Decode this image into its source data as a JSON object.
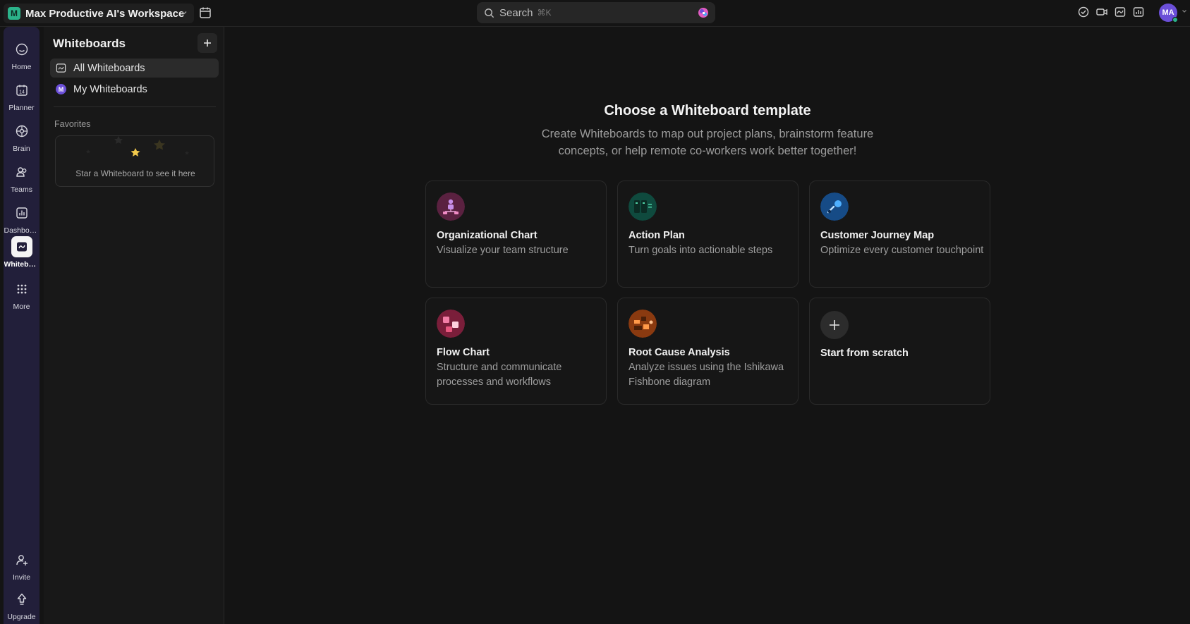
{
  "topbar": {
    "workspace_initial": "M",
    "workspace_name": "Max Productive AI's Workspace",
    "search_placeholder": "Search",
    "search_shortcut": "⌘K",
    "user_initials": "MA"
  },
  "rail": {
    "items": [
      {
        "label": "Home",
        "icon": "home-icon"
      },
      {
        "label": "Planner",
        "icon": "calendar-icon"
      },
      {
        "label": "Brain",
        "icon": "brain-icon"
      },
      {
        "label": "Teams",
        "icon": "teams-icon"
      },
      {
        "label": "Dashboa...",
        "icon": "dashboard-icon"
      },
      {
        "label": "Whitebo...",
        "icon": "whiteboard-icon",
        "active": true
      },
      {
        "label": "More",
        "icon": "grid-icon"
      }
    ],
    "bottom": [
      {
        "label": "Invite",
        "icon": "invite-icon"
      },
      {
        "label": "Upgrade",
        "icon": "upgrade-icon"
      }
    ]
  },
  "sidebar": {
    "title": "Whiteboards",
    "items": [
      {
        "label": "All Whiteboards",
        "icon": "whiteboard-icon",
        "active": true
      },
      {
        "label": "My Whiteboards",
        "icon": "user-badge-icon",
        "badge": "M"
      }
    ],
    "favorites_label": "Favorites",
    "favorites_empty": "Star a Whiteboard to see it here"
  },
  "main": {
    "title": "Choose a Whiteboard template",
    "subtitle": "Create Whiteboards to map out project plans, brainstorm feature concepts, or help remote co-workers work better together!",
    "templates": [
      {
        "title": "Organizational Chart",
        "desc": "Visualize your team structure"
      },
      {
        "title": "Action Plan",
        "desc": "Turn goals into actionable steps"
      },
      {
        "title": "Customer Journey Map",
        "desc": "Optimize every customer touchpoint"
      },
      {
        "title": "Flow Chart",
        "desc": "Structure and communicate processes and workflows"
      },
      {
        "title": "Root Cause Analysis",
        "desc": "Analyze issues using the Ishikawa Fishbone diagram"
      }
    ],
    "scratch_label": "Start from scratch"
  },
  "colors": {
    "accent": "#6b4fd8",
    "workspace": "#2bb38a",
    "rail_bg": "#221f3a",
    "bg": "#141414"
  }
}
